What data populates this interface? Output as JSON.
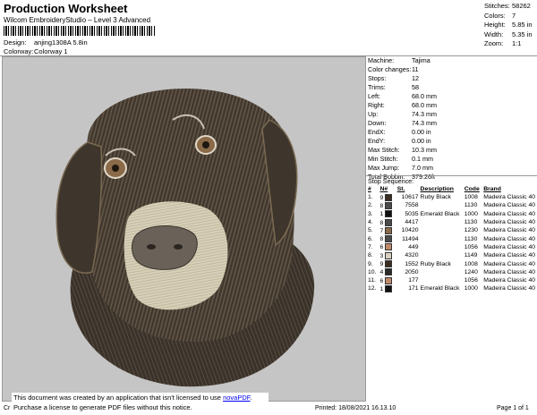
{
  "header": {
    "title": "Production Worksheet",
    "subtitle": "Wilcom EmbroideryStudio – Level 3 Advanced",
    "design_label": "Design:",
    "design_value": "anjing1308A 5.8in",
    "colorway_label": "Colorway:",
    "colorway_value": "Colorway 1"
  },
  "summary": [
    {
      "label": "Stitches:",
      "value": "58262"
    },
    {
      "label": "Colors:",
      "value": "7"
    },
    {
      "label": "Height:",
      "value": "5.85 in"
    },
    {
      "label": "Width:",
      "value": "5.35 in"
    },
    {
      "label": "Zoom:",
      "value": "1:1"
    }
  ],
  "details": [
    {
      "label": "Machine:",
      "value": "Tajima"
    },
    {
      "label": "Color changes:",
      "value": "11"
    },
    {
      "label": "Stops:",
      "value": "12"
    },
    {
      "label": "Trims:",
      "value": "58"
    },
    {
      "label": "Left:",
      "value": "68.0 mm"
    },
    {
      "label": "Right:",
      "value": "68.0 mm"
    },
    {
      "label": "Up:",
      "value": "74.3 mm"
    },
    {
      "label": "Down:",
      "value": "74.3 mm"
    },
    {
      "label": "EndX:",
      "value": "0.00 in"
    },
    {
      "label": "EndY:",
      "value": "0.00 in"
    },
    {
      "label": "Max Stitch:",
      "value": "10.3 mm"
    },
    {
      "label": "Min Stitch:",
      "value": "0.1 mm"
    },
    {
      "label": "Max Jump:",
      "value": "7.0 mm"
    },
    {
      "label": "Total Bobbin:",
      "value": "379.26ft"
    }
  ],
  "stop_sequence": {
    "title": "Stop Sequence:",
    "columns": [
      "#",
      "N#",
      "St.",
      "Description",
      "Code",
      "Brand"
    ],
    "rows": [
      {
        "num": "1.",
        "n": "9",
        "color": "#3a2d22",
        "st": "10617",
        "desc": "Ruby Black",
        "code": "1008",
        "brand": "Madeira Classic 40"
      },
      {
        "num": "2.",
        "n": "8",
        "color": "#4a4a4a",
        "st": "7558",
        "desc": "",
        "code": "1130",
        "brand": "Madeira Classic 40"
      },
      {
        "num": "3.",
        "n": "1",
        "color": "#111111",
        "st": "5035",
        "desc": "Emerald Black",
        "code": "1000",
        "brand": "Madeira Classic 40"
      },
      {
        "num": "4.",
        "n": "8",
        "color": "#4a4a4a",
        "st": "4417",
        "desc": "",
        "code": "1130",
        "brand": "Madeira Classic 40"
      },
      {
        "num": "5.",
        "n": "7",
        "color": "#8a6a4a",
        "st": "10420",
        "desc": "",
        "code": "1230",
        "brand": "Madeira Classic 40"
      },
      {
        "num": "6.",
        "n": "8",
        "color": "#4a4a4a",
        "st": "11494",
        "desc": "",
        "code": "1130",
        "brand": "Madeira Classic 40"
      },
      {
        "num": "7.",
        "n": "6",
        "color": "#c08a6a",
        "st": "449",
        "desc": "",
        "code": "1056",
        "brand": "Madeira Classic 40"
      },
      {
        "num": "8.",
        "n": "3",
        "color": "#d8d0c0",
        "st": "4320",
        "desc": "",
        "code": "1149",
        "brand": "Madeira Classic 40"
      },
      {
        "num": "9.",
        "n": "9",
        "color": "#3a2d22",
        "st": "1552",
        "desc": "Ruby Black",
        "code": "1008",
        "brand": "Madeira Classic 40"
      },
      {
        "num": "10.",
        "n": "4",
        "color": "#2a2a2a",
        "st": "2050",
        "desc": "",
        "code": "1240",
        "brand": "Madeira Classic 40"
      },
      {
        "num": "11.",
        "n": "6",
        "color": "#c08a6a",
        "st": "177",
        "desc": "",
        "code": "1056",
        "brand": "Madeira Classic 40"
      },
      {
        "num": "12.",
        "n": "1",
        "color": "#111111",
        "st": "171",
        "desc": "Emerald Black",
        "code": "1000",
        "brand": "Madeira Classic 40"
      }
    ]
  },
  "notice": {
    "line1_prefix": "This document was created by an application that isn't licensed to use ",
    "link": "novaPDF",
    "line1_suffix": ".",
    "line2": "Purchase a license to generate PDF files without this notice."
  },
  "footer": {
    "left": "Cr",
    "printed": "Printed: 18/08/2021 16.13.10",
    "page": "Page 1 of 1"
  }
}
